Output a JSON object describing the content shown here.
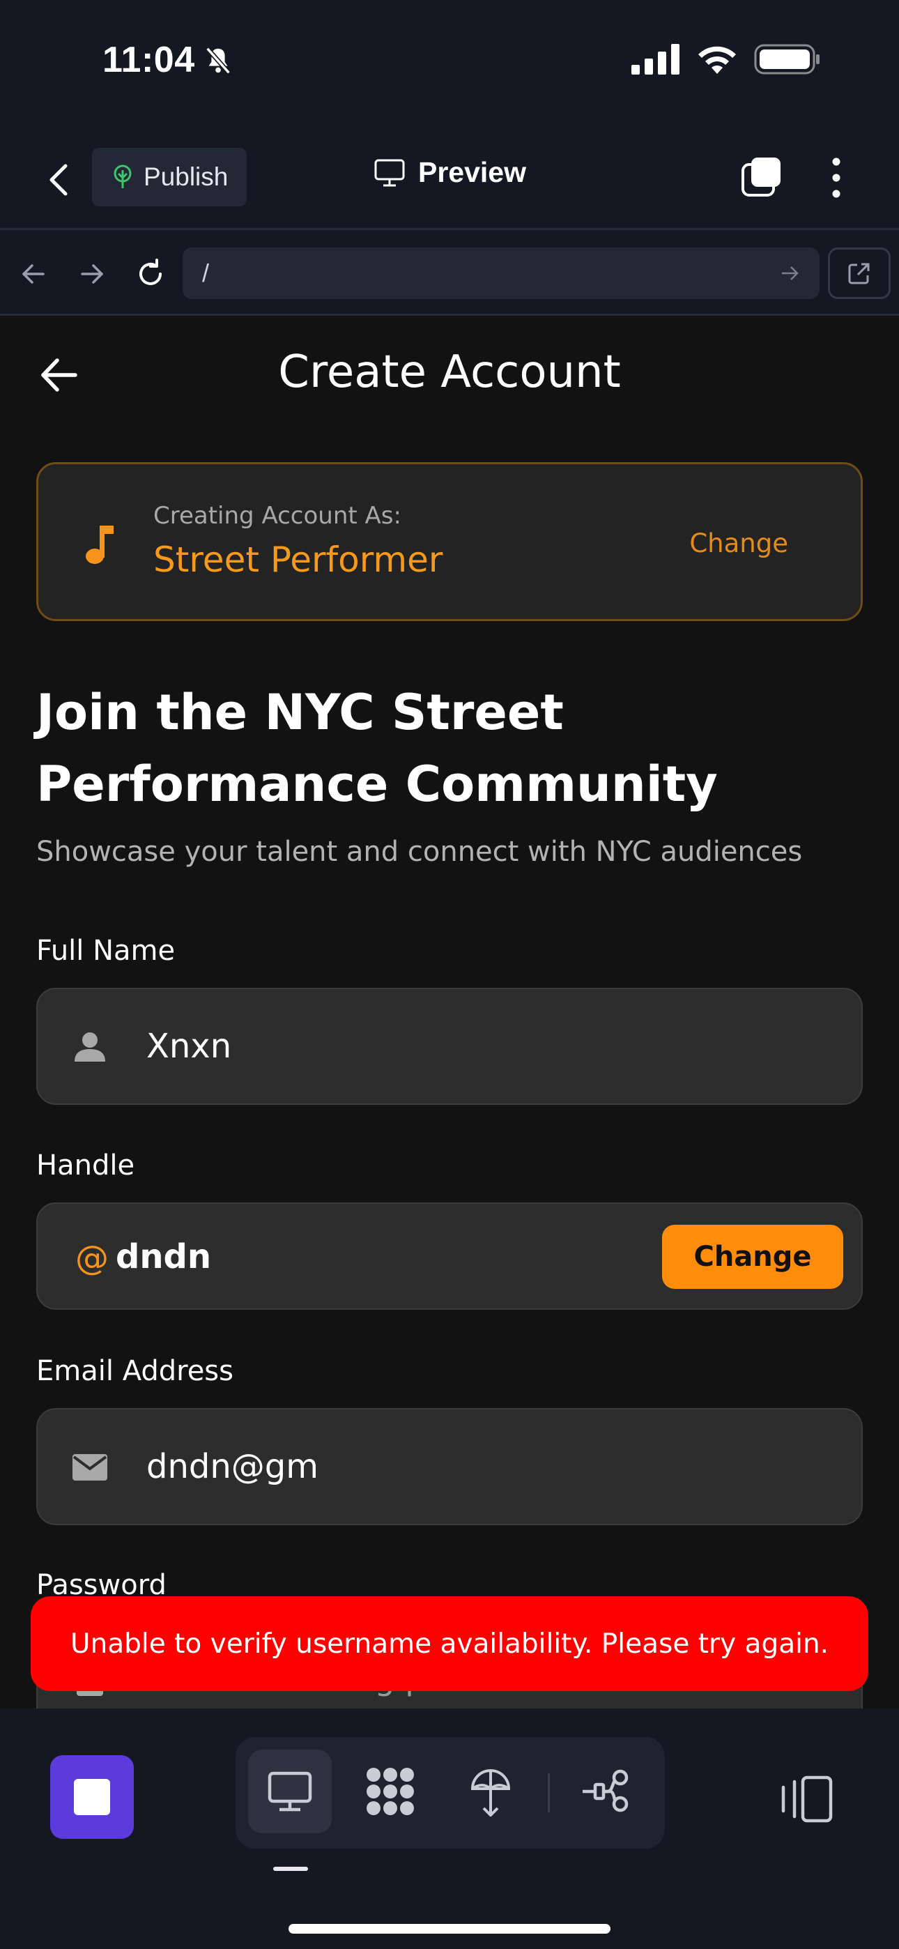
{
  "status_bar": {
    "time": "11:04"
  },
  "top_bar": {
    "publish_label": "Publish",
    "preview_label": "Preview"
  },
  "url_bar": {
    "path": "/"
  },
  "app": {
    "title": "Create Account",
    "role_card": {
      "prefix": "Creating Account As:",
      "role": "Street Performer",
      "change_label": "Change"
    },
    "heading": "Join the NYC Street Performance Community",
    "subheading": "Showcase your talent and connect with NYC audiences",
    "full_name": {
      "label": "Full Name",
      "value": "Xnxn"
    },
    "handle": {
      "label": "Handle",
      "at": "@",
      "value": "dndn",
      "change_label": "Change"
    },
    "email": {
      "label": "Email Address",
      "value": "dndn@gm"
    },
    "password": {
      "label": "Password",
      "placeholder": "Create a strong password"
    }
  },
  "toast": {
    "message": "Unable to verify username availability. Please try again."
  },
  "colors": {
    "accent": "#ff8c0a",
    "error": "#ff0000",
    "brand": "#5b3bdb",
    "background": "#121212"
  },
  "icons": [
    "bell-off-icon",
    "signal-icon",
    "wifi-icon",
    "battery-icon",
    "chevron-left-icon",
    "tree-icon",
    "monitor-icon",
    "copy-icon",
    "more-vertical-icon",
    "arrow-left-icon",
    "arrow-right-icon",
    "refresh-icon",
    "external-link-icon",
    "music-note-icon",
    "person-icon",
    "mail-icon",
    "lock-icon",
    "stop-icon",
    "components-icon",
    "deploy-icon",
    "flow-icon",
    "device-toggle-icon"
  ]
}
